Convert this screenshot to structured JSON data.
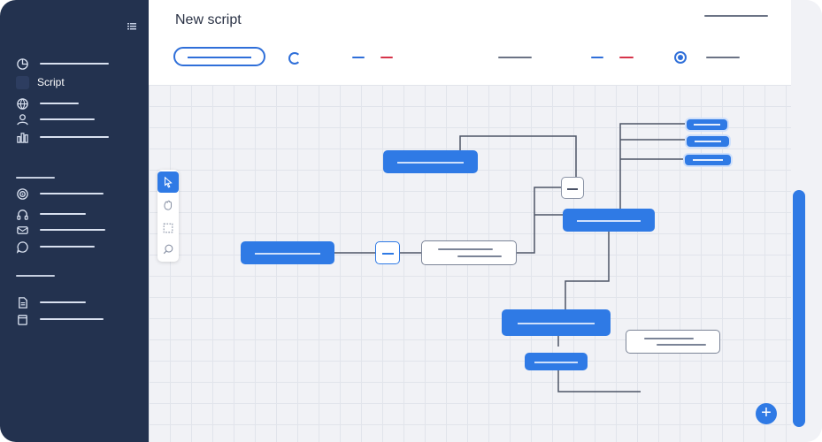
{
  "header": {
    "title": "New script"
  },
  "sidebar": {
    "active_item": "Script",
    "icons": [
      "pie-chart-icon",
      "script-icon",
      "globe-icon",
      "users-icon",
      "bar-chart-icon",
      "target-icon",
      "headphones-icon",
      "mail-icon",
      "chat-icon",
      "document-icon",
      "archive-icon"
    ]
  },
  "toolbar": {
    "tools": [
      "pointer-icon",
      "hand-icon",
      "select-area-icon",
      "zoom-icon"
    ]
  },
  "fab": {
    "label": "+"
  },
  "colors": {
    "accent": "#2f7ae5",
    "sidebar": "#23324f",
    "marker_red": "#d6344a"
  }
}
